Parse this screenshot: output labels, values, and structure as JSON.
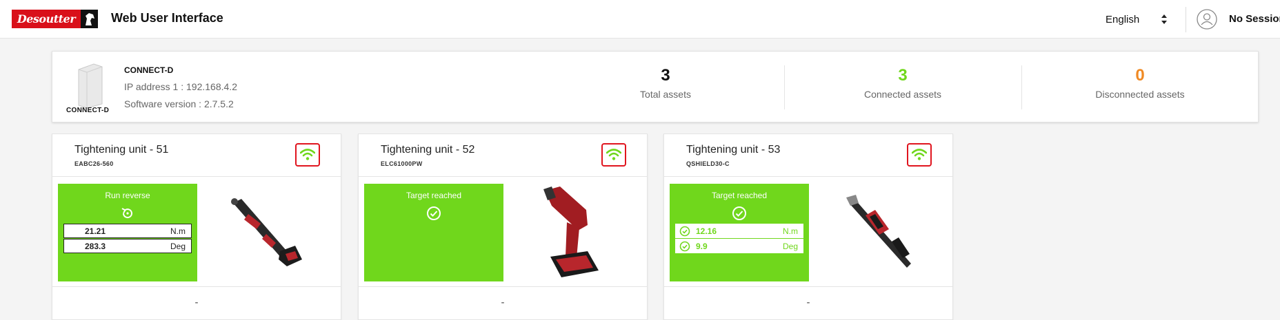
{
  "header": {
    "logo_text": "Desoutter",
    "app_title": "Web User Interface",
    "language": "English",
    "session": "No Session"
  },
  "controller": {
    "image_caption": "CONNECT-D",
    "name": "CONNECT-D",
    "ip": "IP address 1 : 192.168.4.2",
    "software": "Software version : 2.7.5.2"
  },
  "stats": {
    "total": {
      "value": "3",
      "label": "Total assets",
      "color": "#111111"
    },
    "connected": {
      "value": "3",
      "label": "Connected assets",
      "color": "#70d71c"
    },
    "disconnected": {
      "value": "0",
      "label": "Disconnected assets",
      "color": "#f08a24"
    }
  },
  "units": [
    {
      "title": "Tightening unit - 51",
      "model": "EABC26-560",
      "status": "Run reverse",
      "status_icon": "reverse-icon",
      "results": [
        {
          "value": "21.21",
          "unit": "N.m"
        },
        {
          "value": "283.3",
          "unit": "Deg"
        }
      ],
      "footer": "-"
    },
    {
      "title": "Tightening unit - 52",
      "model": "ELC61000PW",
      "status": "Target reached",
      "status_icon": "check-circle-icon",
      "results": [],
      "footer": "-"
    },
    {
      "title": "Tightening unit - 53",
      "model": "QSHIELD30-C",
      "status": "Target reached",
      "status_icon": "check-circle-icon",
      "results": [
        {
          "value": "12.16",
          "unit": "N.m"
        },
        {
          "value": "9.9",
          "unit": "Deg"
        }
      ],
      "footer": "-"
    }
  ],
  "colors": {
    "brand_red": "#d9101a",
    "status_green": "#70d71c",
    "disconnected_orange": "#f08a24"
  }
}
